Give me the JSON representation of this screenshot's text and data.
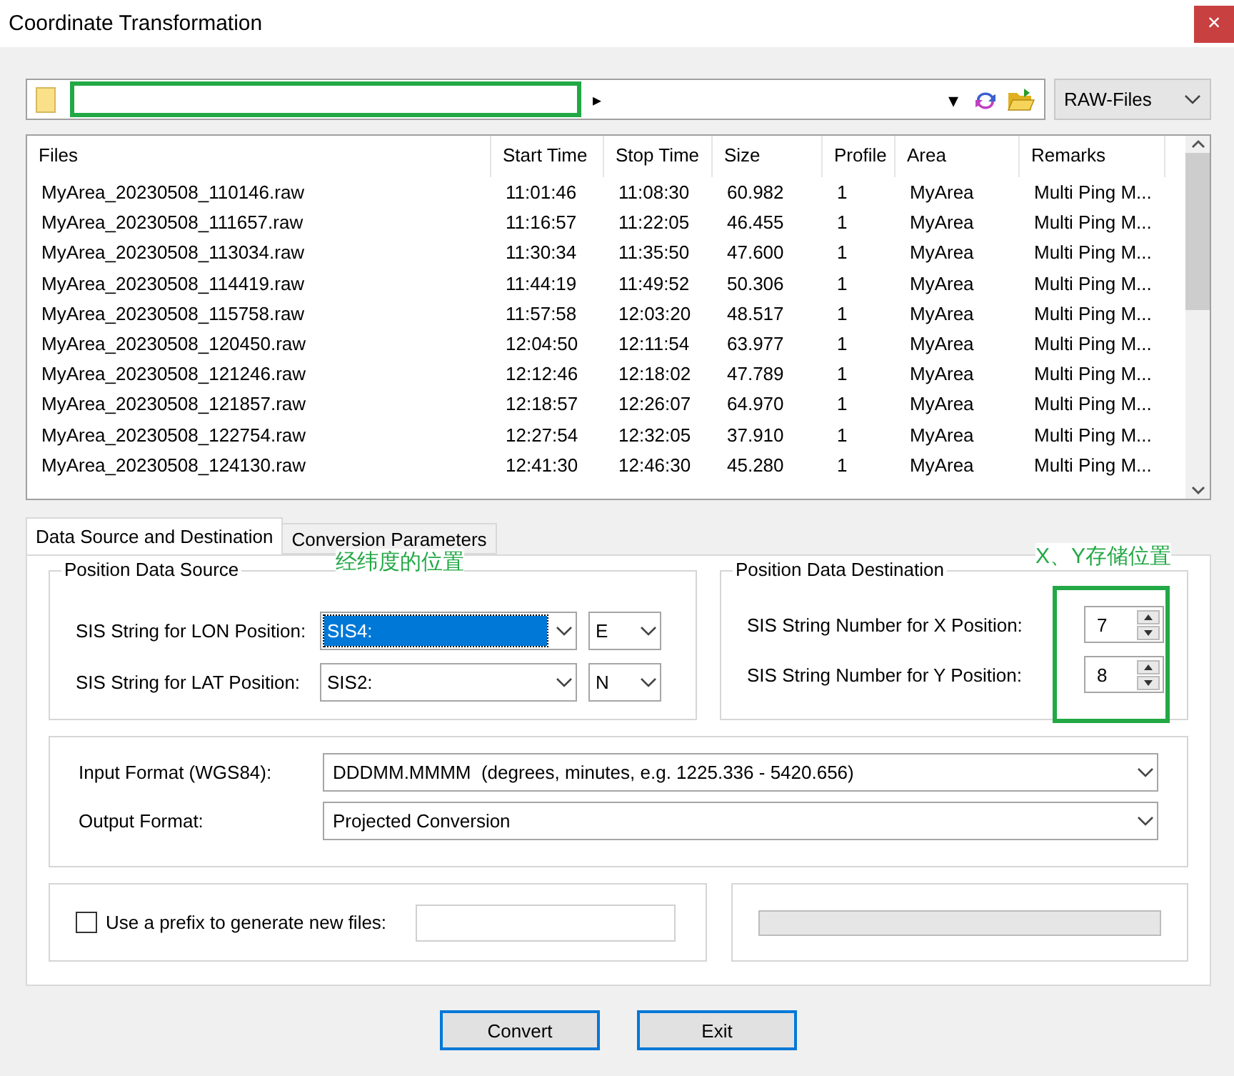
{
  "window": {
    "title": "Coordinate Transformation",
    "close": "×"
  },
  "path_bar": {
    "arrow": "▸",
    "dropdown": "▾",
    "filter": "RAW-Files"
  },
  "table": {
    "columns": [
      "Files",
      "Start Time",
      "Stop Time",
      "Size",
      "Profile",
      "Area",
      "Remarks"
    ],
    "rows": [
      [
        "MyArea_20230508_110146.raw",
        "11:01:46",
        "11:08:30",
        "60.982",
        "1",
        "MyArea",
        "Multi Ping M..."
      ],
      [
        "MyArea_20230508_111657.raw",
        "11:16:57",
        "11:22:05",
        "46.455",
        "1",
        "MyArea",
        "Multi Ping M..."
      ],
      [
        "MyArea_20230508_113034.raw",
        "11:30:34",
        "11:35:50",
        "47.600",
        "1",
        "MyArea",
        "Multi Ping M..."
      ],
      [
        "MyArea_20230508_114419.raw",
        "11:44:19",
        "11:49:52",
        "50.306",
        "1",
        "MyArea",
        "Multi Ping M..."
      ],
      [
        "MyArea_20230508_115758.raw",
        "11:57:58",
        "12:03:20",
        "48.517",
        "1",
        "MyArea",
        "Multi Ping M..."
      ],
      [
        "MyArea_20230508_120450.raw",
        "12:04:50",
        "12:11:54",
        "63.977",
        "1",
        "MyArea",
        "Multi Ping M..."
      ],
      [
        "MyArea_20230508_121246.raw",
        "12:12:46",
        "12:18:02",
        "47.789",
        "1",
        "MyArea",
        "Multi Ping M..."
      ],
      [
        "MyArea_20230508_121857.raw",
        "12:18:57",
        "12:26:07",
        "64.970",
        "1",
        "MyArea",
        "Multi Ping M..."
      ],
      [
        "MyArea_20230508_122754.raw",
        "12:27:54",
        "12:32:05",
        "37.910",
        "1",
        "MyArea",
        "Multi Ping M..."
      ],
      [
        "MyArea_20230508_124130.raw",
        "12:41:30",
        "12:46:30",
        "45.280",
        "1",
        "MyArea",
        "Multi Ping M..."
      ]
    ]
  },
  "tabs": [
    {
      "label": "Data Source and Destination",
      "selected": true
    },
    {
      "label": "Conversion Parameters",
      "selected": false
    }
  ],
  "source": {
    "title": "Position Data Source",
    "note": "经纬度的位置",
    "rows": [
      {
        "label": "SIS String for LON Position:",
        "value": "SIS4:",
        "selected": true,
        "hemisphere": "E"
      },
      {
        "label": "SIS String for LAT Position:",
        "value": "SIS2:",
        "selected": false,
        "hemisphere": "N"
      }
    ]
  },
  "destination": {
    "title": "Position Data Destination",
    "note": "X、Y存储位置",
    "rows": [
      {
        "label": "SIS String Number for X Position:",
        "value": "7"
      },
      {
        "label": "SIS String Number for Y Position:",
        "value": "8"
      }
    ]
  },
  "formats": [
    {
      "label": "Input Format (WGS84):",
      "value": "DDDMM.MMMM  (degrees, minutes, e.g. 1225.336 - 5420.656)"
    },
    {
      "label": "Output Format:",
      "value": "Projected Conversion"
    }
  ],
  "prefix": {
    "label": "Use a prefix to generate new files:",
    "checked": false
  },
  "progress": {
    "level": 0
  },
  "buttons": [
    "Convert",
    "Exit"
  ]
}
